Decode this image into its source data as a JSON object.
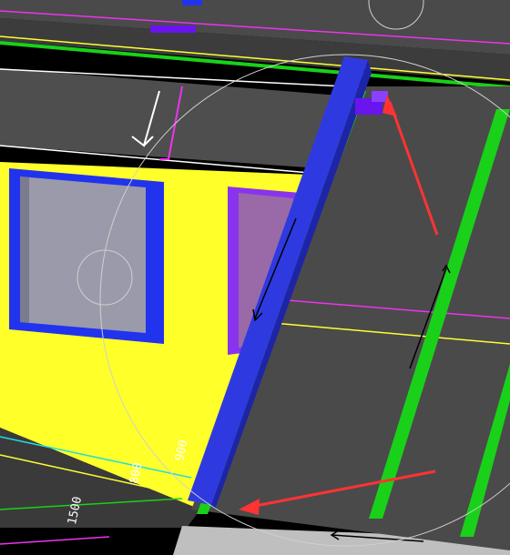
{
  "viewport": {
    "description_free": true,
    "colors": {
      "slab": "#4a4a4a",
      "slab_dark": "#3a3a3a",
      "ground": "#bfbfbf",
      "wall": "#ffff2a",
      "window_frame": "#2233ee",
      "window_glass": "#9a9aaa",
      "door_frame": "#8a33ee",
      "door_glass": "#9a6aa8",
      "beam": "#2e3ae0",
      "green_line": "#19d119",
      "yellow_line": "#ffff33",
      "magenta_line": "#ee33ee",
      "cyan_line": "#22dddd",
      "red_arrow": "#ff3333",
      "orbit_circle": "#cccccc",
      "marker": "#6a14ee"
    },
    "icons": {
      "rotate_arrow": "rotate-cursor-icon",
      "marker_block": "section-marker-icon"
    }
  },
  "dimension_labels": [
    {
      "text": "1500"
    },
    {
      "text": "800"
    },
    {
      "text": "900"
    }
  ]
}
